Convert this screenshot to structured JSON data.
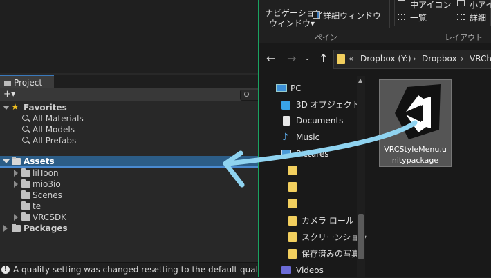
{
  "unity": {
    "project_tab": "Project",
    "add_button": "+▾",
    "favorites": {
      "label": "Favorites",
      "items": [
        "All Materials",
        "All Models",
        "All Prefabs"
      ]
    },
    "assets": {
      "label": "Assets",
      "children": [
        "lilToon",
        "mio3io",
        "Scenes",
        "te",
        "VRCSDK"
      ]
    },
    "packages": {
      "label": "Packages"
    },
    "status_message": "A quality setting was changed resetting to the default quality: Ul"
  },
  "explorer": {
    "ribbon": {
      "nav_pane_line1": "ナビゲーション",
      "nav_pane_line2": "ウィンドウ▾",
      "details_pane": "詳細ウィンドウ",
      "pane_group": "ペイン",
      "medium_icons": "中アイコン",
      "small_icons": "小アイ",
      "list": "一覧",
      "details": "詳細",
      "layout_group": "レイアウト"
    },
    "address": {
      "chevrons": "«",
      "segments": [
        "Dropbox (Y:)",
        "Dropbox",
        "VRCha"
      ],
      "separator": "›"
    },
    "nav_items": [
      {
        "label": "PC",
        "icon": "pc-icon"
      },
      {
        "label": "3D オブジェクト",
        "icon": "3d-objects-icon"
      },
      {
        "label": "Documents",
        "icon": "documents-icon"
      },
      {
        "label": "Music",
        "icon": "music-icon"
      },
      {
        "label": "Pictures",
        "icon": "pictures-icon"
      },
      {
        "label": "",
        "icon": "folder-icon"
      },
      {
        "label": "",
        "icon": "folder-icon"
      },
      {
        "label": "",
        "icon": "folder-icon"
      },
      {
        "label": "カメラ ロール",
        "icon": "folder-icon"
      },
      {
        "label": "スクリーンショット",
        "icon": "folder-icon"
      },
      {
        "label": "保存済みの写真",
        "icon": "folder-icon"
      },
      {
        "label": "Videos",
        "icon": "videos-icon"
      }
    ],
    "file": {
      "name_line1": "VRCStyleMenu.u",
      "name_line2": "nitypackage",
      "icon": "unity-logo-icon"
    }
  },
  "colors": {
    "selection": "#2c5d87",
    "divider": "#1aa261",
    "arrow": "#8fd3f0",
    "folder_yellow": "#f2cf5e"
  }
}
